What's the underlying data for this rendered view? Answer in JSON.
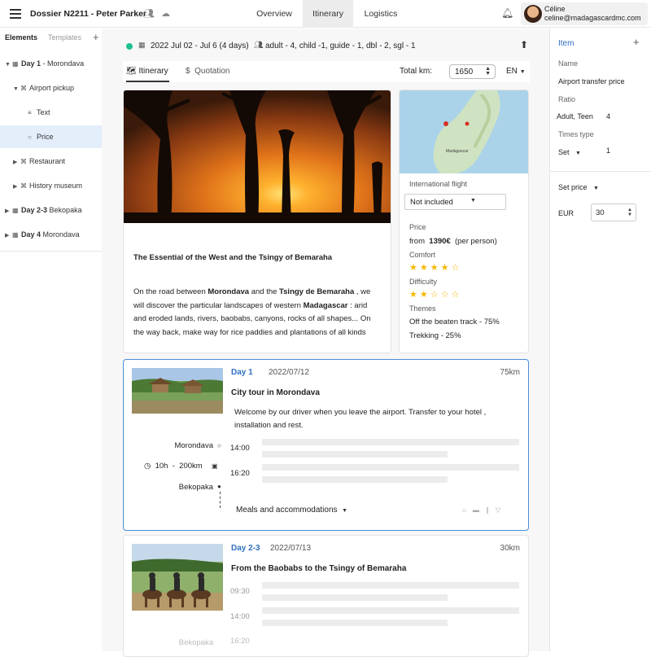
{
  "header": {
    "title": "Dossier N2211 - Peter Parker",
    "tabs": [
      {
        "label": "Overview",
        "active": false
      },
      {
        "label": "Itinerary",
        "active": true
      },
      {
        "label": "Logistics",
        "active": false
      }
    ],
    "user": {
      "name": "Céline",
      "email": "celine@madagascardmc.com"
    },
    "icons": [
      "menu-icon",
      "people-icon",
      "cloud-icon",
      "bell-icon"
    ]
  },
  "left_panel": {
    "tabs": [
      "Elements",
      "Templates"
    ],
    "tree": [
      {
        "day": "Day 1",
        "label": "- Morondava",
        "expanded": true
      },
      {
        "label": "Airport pickup",
        "expanded": true
      },
      {
        "label": "Text"
      },
      {
        "label": "Price",
        "selected": true
      },
      {
        "label": "Restaurant"
      },
      {
        "label": "History museum"
      },
      {
        "day": "Day 2-3",
        "label": "Bekopaka"
      },
      {
        "day": "Day 4",
        "label": "Morondava"
      }
    ]
  },
  "trip": {
    "dates": "2022 Jul 02 - Jul 6 (4 days)",
    "people": "adult - 4, child -1, guide - 1, dbl - 2, sgl - 1",
    "status_color": "#1fbf8f"
  },
  "subtabs": {
    "itinerary": "Itinerary",
    "quotation": "Quotation"
  },
  "total_km": {
    "label": "Total km:",
    "value": "1650"
  },
  "language": "EN",
  "intro": {
    "title": "The Essential of the West and the Tsingy of Bemaraha",
    "text_parts": [
      "On the road between ",
      "Morondava",
      " and the ",
      "Tsingy de Bemaraha",
      " , we will discover the particular landscapes of western ",
      "Madagascar",
      " : arid and eroded lands, rivers, baobabs, canyons, rocks of all shapes... On the way back, make way for rice paddies and plantations of all kinds"
    ]
  },
  "map": {
    "country_label": "Madagascar"
  },
  "summary": {
    "flight_label": "International flight",
    "flight_value": "Not included",
    "price_label": "Price",
    "price_from": "from",
    "price_value": "1390€",
    "price_per": "(per person)",
    "comfort_label": "Comfort",
    "comfort_rating": 4,
    "difficulty_label": "Difficulty",
    "difficulty_rating": 2,
    "themes_label": "Themes",
    "themes": [
      "Off the beaten track - 75%",
      "Trekking - 25%"
    ],
    "max_rating": 5
  },
  "days": [
    {
      "label": "Day 1",
      "date": "2022/07/12",
      "km": "75km",
      "title": "City tour in Morondava",
      "desc": "Welcome by our driver when you leave the airport. Transfer to your hotel , installation and rest.",
      "from": "Morondava",
      "to": "Bekopaka",
      "times": [
        "14:00",
        "16:20"
      ],
      "duration": "10h",
      "distance": "200km",
      "meals": "Meals and accommodations"
    },
    {
      "label": "Day 2-3",
      "date": "2022/07/13",
      "km": "30km",
      "title": "From the Baobabs to the Tsingy of Bemaraha",
      "times": [
        "09:30",
        "14:00",
        "16:20"
      ],
      "to": "Bekopaka"
    }
  ],
  "right_panel": {
    "title": "Item",
    "name_label": "Name",
    "name_value": "Airport transfer price",
    "ratio_label": "Ratio",
    "ratio_name": "Adult, Teen",
    "ratio_value": "4",
    "times_label": "Times type",
    "times_value": "Set",
    "times_count": "1",
    "set_price_label": "Set price",
    "currency": "EUR",
    "price": "30"
  }
}
